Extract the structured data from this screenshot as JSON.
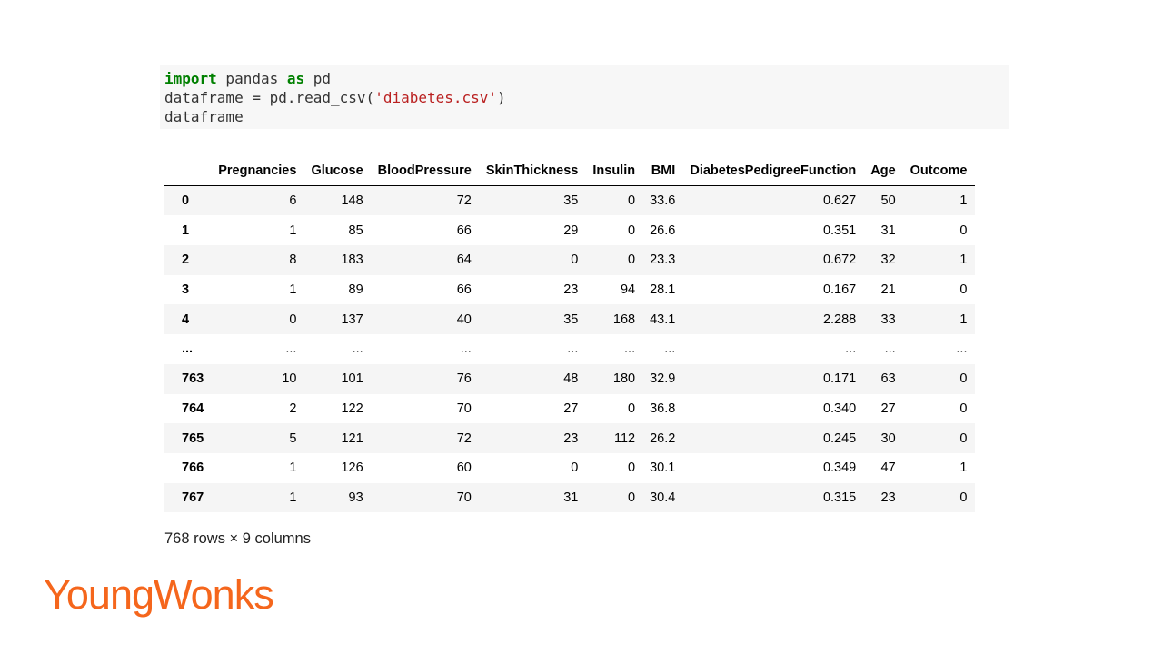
{
  "code_cell": {
    "line1": {
      "kw1": "import",
      "mid": " pandas ",
      "kw2": "as",
      "tail": " pd"
    },
    "line2": {
      "pre": "dataframe = pd.read_csv(",
      "str": "'diabetes.csv'",
      "post": ")"
    },
    "line3": "dataframe"
  },
  "table": {
    "index_header": "",
    "columns": [
      "Pregnancies",
      "Glucose",
      "BloodPressure",
      "SkinThickness",
      "Insulin",
      "BMI",
      "DiabetesPedigreeFunction",
      "Age",
      "Outcome"
    ],
    "rows": [
      {
        "index": "0",
        "values": [
          "6",
          "148",
          "72",
          "35",
          "0",
          "33.6",
          "0.627",
          "50",
          "1"
        ]
      },
      {
        "index": "1",
        "values": [
          "1",
          "85",
          "66",
          "29",
          "0",
          "26.6",
          "0.351",
          "31",
          "0"
        ]
      },
      {
        "index": "2",
        "values": [
          "8",
          "183",
          "64",
          "0",
          "0",
          "23.3",
          "0.672",
          "32",
          "1"
        ]
      },
      {
        "index": "3",
        "values": [
          "1",
          "89",
          "66",
          "23",
          "94",
          "28.1",
          "0.167",
          "21",
          "0"
        ]
      },
      {
        "index": "4",
        "values": [
          "0",
          "137",
          "40",
          "35",
          "168",
          "43.1",
          "2.288",
          "33",
          "1"
        ]
      },
      {
        "index": "...",
        "values": [
          "...",
          "...",
          "...",
          "...",
          "...",
          "...",
          "...",
          "...",
          "..."
        ]
      },
      {
        "index": "763",
        "values": [
          "10",
          "101",
          "76",
          "48",
          "180",
          "32.9",
          "0.171",
          "63",
          "0"
        ]
      },
      {
        "index": "764",
        "values": [
          "2",
          "122",
          "70",
          "27",
          "0",
          "36.8",
          "0.340",
          "27",
          "0"
        ]
      },
      {
        "index": "765",
        "values": [
          "5",
          "121",
          "72",
          "23",
          "112",
          "26.2",
          "0.245",
          "30",
          "0"
        ]
      },
      {
        "index": "766",
        "values": [
          "1",
          "126",
          "60",
          "0",
          "0",
          "30.1",
          "0.349",
          "47",
          "1"
        ]
      },
      {
        "index": "767",
        "values": [
          "1",
          "93",
          "70",
          "31",
          "0",
          "30.4",
          "0.315",
          "23",
          "0"
        ]
      }
    ]
  },
  "shape_note": "768 rows × 9 columns",
  "logo_text": "YoungWonks",
  "colors": {
    "brand": "#f5661c",
    "keyword": "#008000",
    "string": "#ba2121",
    "code_background": "#f7f7f7",
    "row_stripe": "#f5f5f5"
  }
}
